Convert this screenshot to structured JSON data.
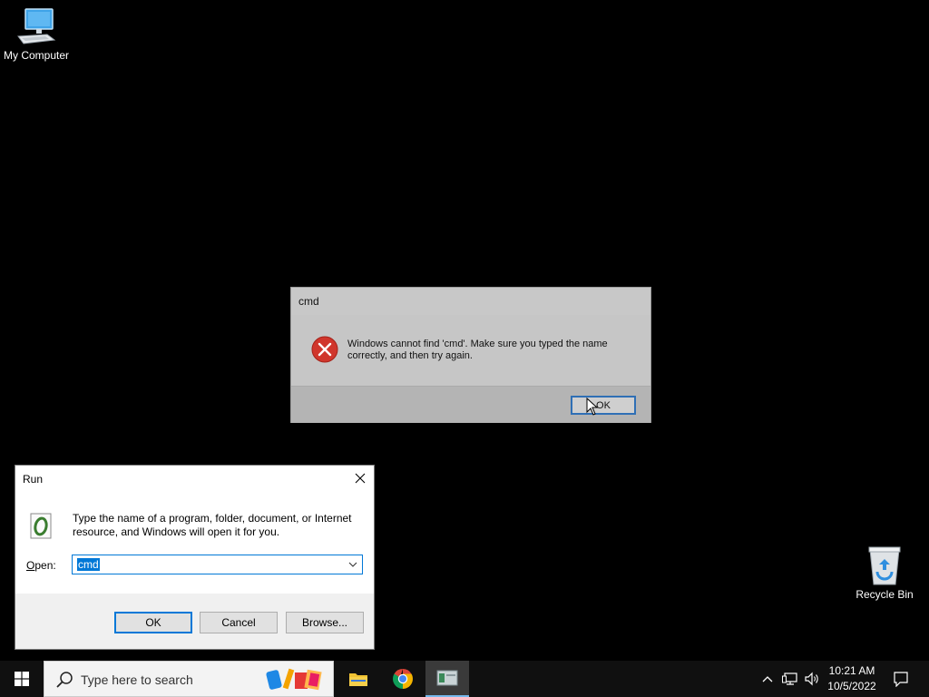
{
  "desktop": {
    "my_computer_label": "My Computer",
    "recycle_bin_label": "Recycle Bin"
  },
  "error_dialog": {
    "title": "cmd",
    "message": "Windows cannot find 'cmd'. Make sure you typed the name correctly, and then try again.",
    "ok_label": "OK",
    "icon": "error-icon"
  },
  "run_dialog": {
    "title": "Run",
    "description": "Type the name of a program, folder, document, or Internet resource, and Windows will open it for you.",
    "open_label_prefix": "O",
    "open_label_rest": "pen:",
    "open_value": "cmd",
    "ok_label": "OK",
    "cancel_label": "Cancel",
    "browse_label": "Browse..."
  },
  "taskbar": {
    "search_placeholder": "Type here to search",
    "clock_time": "10:21 AM",
    "clock_date": "10/5/2022"
  },
  "colors": {
    "accent": "#0078d7",
    "error_red": "#d0362c"
  }
}
